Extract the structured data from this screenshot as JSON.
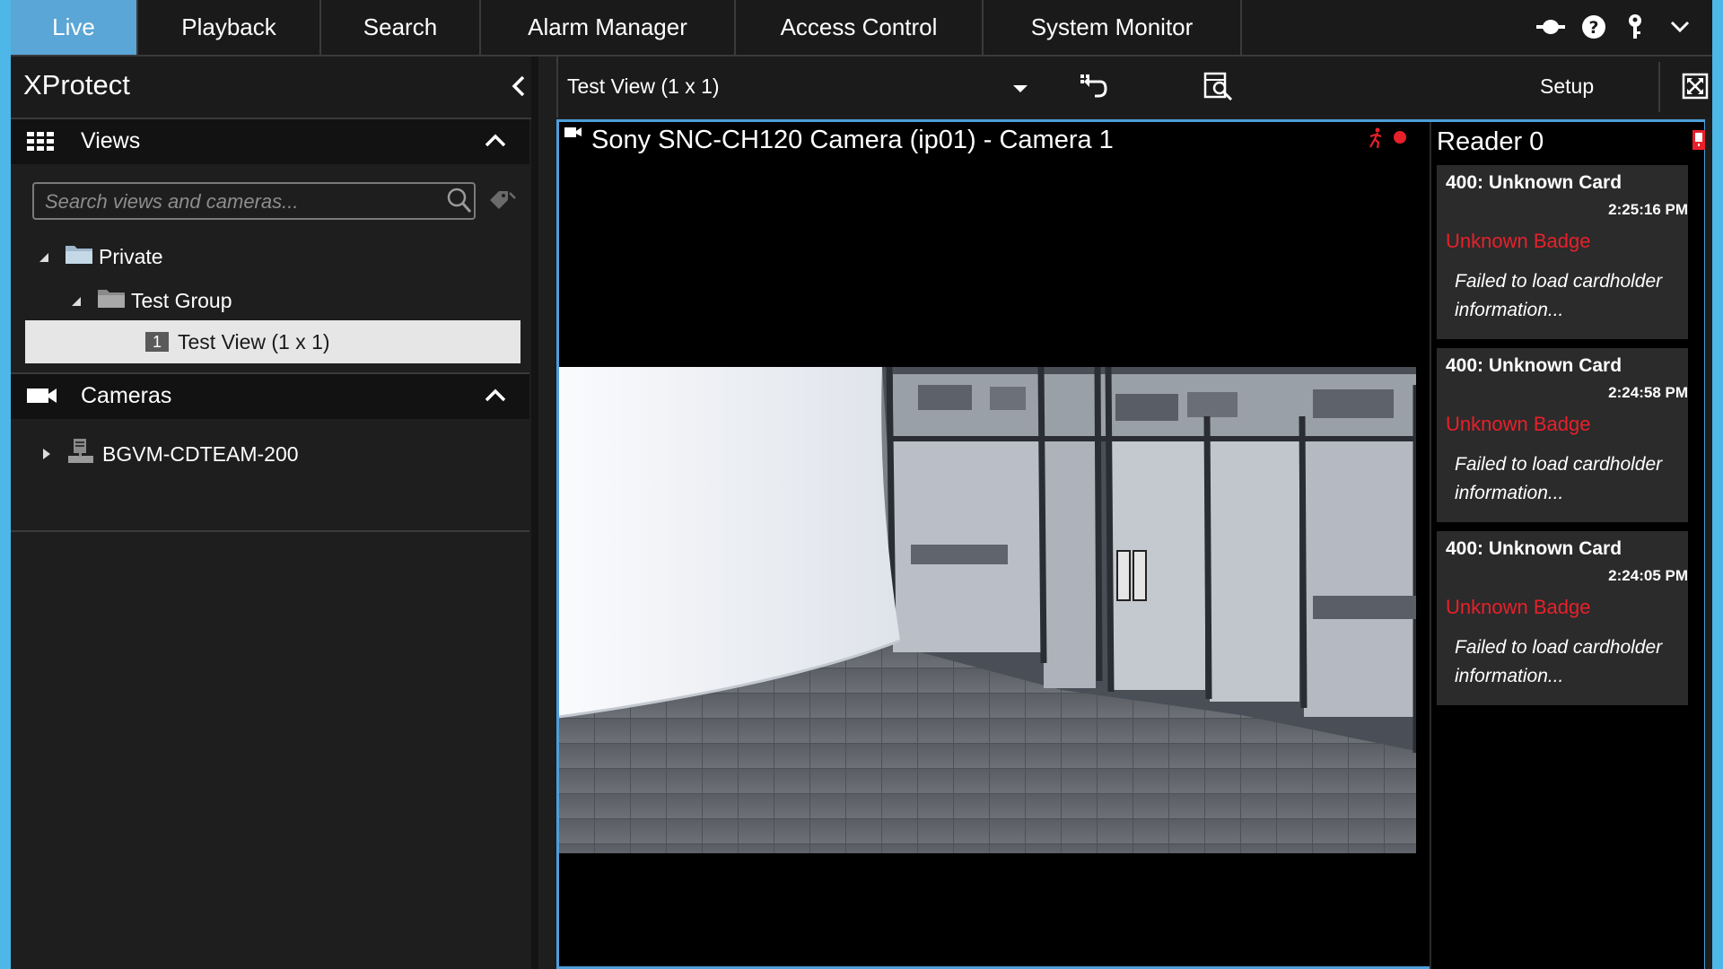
{
  "tabs": [
    "Live",
    "Playback",
    "Search",
    "Alarm Manager",
    "Access Control",
    "System Monitor"
  ],
  "top_icons": [
    "connection-icon",
    "help-icon",
    "key-icon",
    "chevron-down-icon"
  ],
  "app": {
    "title": "XProtect"
  },
  "toolbar": {
    "current_view": "Test View (1 x 1)",
    "setup_label": "Setup"
  },
  "views_section": {
    "title": "Views",
    "search_placeholder": "Search views and cameras...",
    "tree": [
      {
        "label": "Private"
      },
      {
        "label": "Test Group"
      },
      {
        "badge": "1",
        "label": "Test View (1 x 1)"
      }
    ]
  },
  "cameras_section": {
    "title": "Cameras",
    "items": [
      {
        "label": "BGVM-CDTEAM-200"
      }
    ]
  },
  "camera_view": {
    "title": "Sony SNC-CH120 Camera (ip01) - Camera 1",
    "status_colors": {
      "motion": "#e8202a",
      "recording": "#e8202a"
    }
  },
  "reader_panel": {
    "title": "Reader 0",
    "events": [
      {
        "header": "400: Unknown Card",
        "time": "2:25:16 PM",
        "badge": "Unknown Badge",
        "message": "Failed to load cardholder information..."
      },
      {
        "header": "400: Unknown Card",
        "time": "2:24:58 PM",
        "badge": "Unknown Badge",
        "message": "Failed to load cardholder information..."
      },
      {
        "header": "400: Unknown Card",
        "time": "2:24:05 PM",
        "badge": "Unknown Badge",
        "message": "Failed to load cardholder information..."
      }
    ]
  },
  "colors": {
    "accent": "#5aa6d6",
    "alert": "#e8202a",
    "frame": "#4d9fd9"
  }
}
